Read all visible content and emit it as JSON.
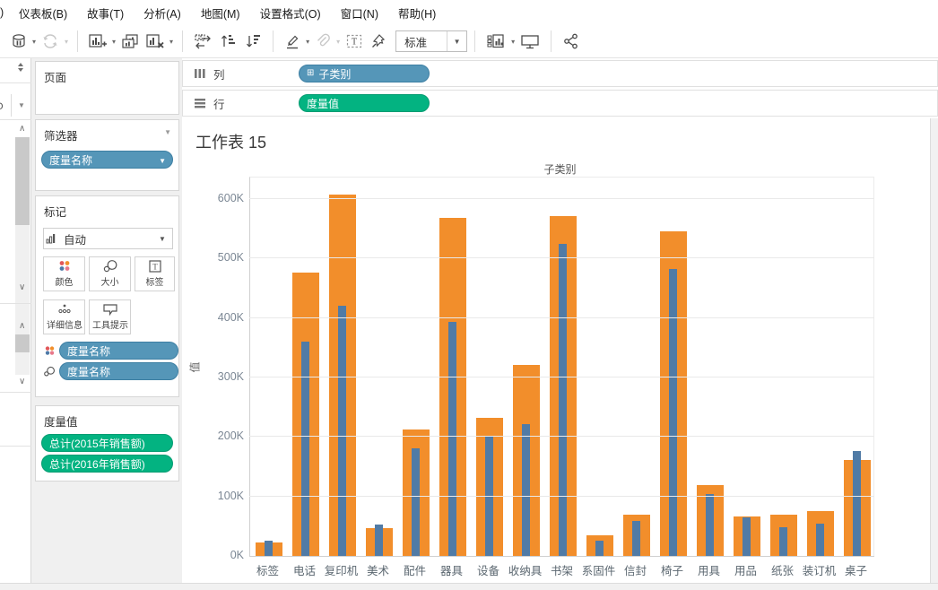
{
  "menu": {
    "cropped_fragment": ")",
    "items": [
      {
        "name": "dashboard",
        "label": "仪表板(B)"
      },
      {
        "name": "story",
        "label": "故事(T)"
      },
      {
        "name": "analysis",
        "label": "分析(A)"
      },
      {
        "name": "map",
        "label": "地图(M)"
      },
      {
        "name": "format",
        "label": "设置格式(O)"
      },
      {
        "name": "window",
        "label": "窗口(N)"
      },
      {
        "name": "help",
        "label": "帮助(H)"
      }
    ]
  },
  "toolbar": {
    "fit_mode": "标准"
  },
  "left_panel": {
    "pages": {
      "title": "页面"
    },
    "filters": {
      "title": "筛选器",
      "pill": "度量名称"
    },
    "marks": {
      "title": "标记",
      "mark_type": "自动",
      "buttons": [
        {
          "label": "颜色"
        },
        {
          "label": "大小"
        },
        {
          "label": "标签"
        },
        {
          "label": "详细信息"
        },
        {
          "label": "工具提示"
        }
      ],
      "pills": [
        {
          "role": "color",
          "label": "度量名称"
        },
        {
          "role": "size",
          "label": "度量名称"
        }
      ]
    },
    "measure_values": {
      "title": "度量值",
      "pills": [
        {
          "label": "总计(2015年销售额)"
        },
        {
          "label": "总计(2016年销售额)"
        }
      ]
    }
  },
  "shelves": {
    "columns": {
      "label": "列",
      "pill": "子类别"
    },
    "rows": {
      "label": "行",
      "pill": "度量值"
    }
  },
  "sheet": {
    "title": "工作表 15"
  },
  "chart_data": {
    "type": "bar",
    "title": "子类别",
    "ylabel": "值",
    "categories": [
      "标签",
      "电话",
      "复印机",
      "美术",
      "配件",
      "器具",
      "设备",
      "收纳具",
      "书架",
      "系固件",
      "信封",
      "椅子",
      "用具",
      "用品",
      "纸张",
      "装订机",
      "桌子"
    ],
    "series": [
      {
        "name": "总计(2016年销售额)",
        "color": "#F28E2B",
        "bar_style": "wide",
        "values": [
          23000,
          477000,
          608000,
          47000,
          212000,
          569000,
          232000,
          321000,
          572000,
          35000,
          69000,
          545000,
          119000,
          67000,
          70000,
          76000,
          162000
        ]
      },
      {
        "name": "总计(2015年销售额)",
        "color": "#507BA6",
        "bar_style": "narrow",
        "values": [
          26000,
          360000,
          420000,
          53000,
          181000,
          393000,
          202000,
          221000,
          525000,
          25000,
          59000,
          482000,
          104000,
          65000,
          49000,
          55000,
          177000
        ]
      }
    ],
    "y_ticks": [
      "0K",
      "100K",
      "200K",
      "300K",
      "400K",
      "500K",
      "600K"
    ],
    "ylim": [
      0,
      637000
    ],
    "grid": true,
    "legend_position": "none"
  },
  "colors": {
    "bar_orange": "#F28E2B",
    "bar_blue": "#507BA6",
    "pill_blue": "#5596B8",
    "pill_green": "#03B381"
  }
}
